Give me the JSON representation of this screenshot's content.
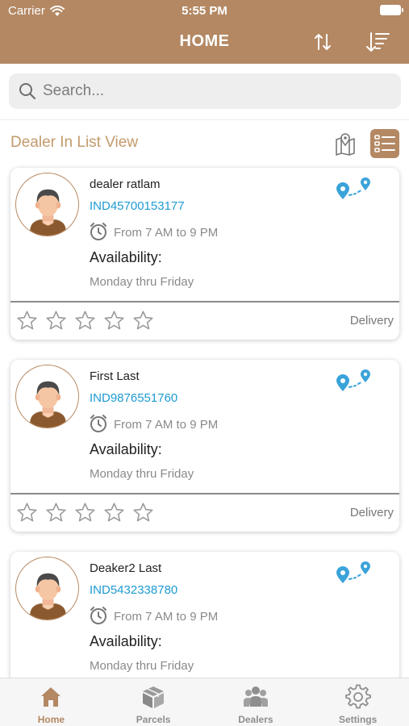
{
  "status_bar": {
    "carrier": "Carrier",
    "time": "5:55 PM"
  },
  "header": {
    "title": "HOME"
  },
  "search": {
    "placeholder": "Search..."
  },
  "section": {
    "title": "Dealer In List View"
  },
  "dealers": [
    {
      "name": "dealer ratlam",
      "code": "IND45700153177",
      "hours": "From 7 AM to 9 PM",
      "availability_label": "Availability:",
      "days": "Monday thru Friday",
      "tag": "Delivery",
      "rating": 0
    },
    {
      "name": "First Last",
      "code": "IND9876551760",
      "hours": "From 7 AM to 9 PM",
      "availability_label": "Availability:",
      "days": "Monday thru Friday",
      "tag": "Delivery",
      "rating": 0
    },
    {
      "name": "Deaker2 Last",
      "code": "IND5432338780",
      "hours": "From 7 AM to 9 PM",
      "availability_label": "Availability:",
      "days": "Monday thru Friday",
      "tag": "",
      "rating": 0
    }
  ],
  "tabs": [
    {
      "label": "Home",
      "icon": "home-icon",
      "active": true
    },
    {
      "label": "Parcels",
      "icon": "parcels-icon",
      "active": false
    },
    {
      "label": "Dealers",
      "icon": "dealers-icon",
      "active": false
    },
    {
      "label": "Settings",
      "icon": "settings-icon",
      "active": false
    }
  ],
  "colors": {
    "brand": "#b38863",
    "accent_text": "#c39a6b",
    "code_blue": "#1e9bd2",
    "pin_blue": "#3aa3d9"
  }
}
